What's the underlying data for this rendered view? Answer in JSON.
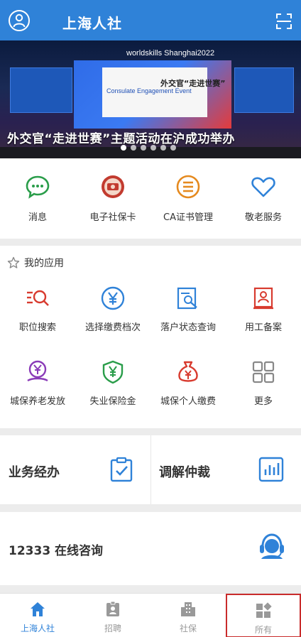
{
  "header": {
    "title": "上海人社",
    "avatar_icon": "user-circle-icon",
    "scan_icon": "scan-icon"
  },
  "banner": {
    "top_text": "worldskills  Shanghai2022",
    "mid_cn": "外交官“走进世赛”",
    "mid_en": "Consulate Engagement Event",
    "headline": "外交官“走进世赛”主题活动在沪成功举办",
    "dots": 6,
    "active_dot": 0
  },
  "quick": [
    {
      "label": "消息",
      "icon": "message-icon",
      "color": "#2a9d4a"
    },
    {
      "label": "电子社保卡",
      "icon": "social-card-icon",
      "color": "#c23b2f"
    },
    {
      "label": "CA证书管理",
      "icon": "certificate-icon",
      "color": "#e58a1f"
    },
    {
      "label": "敬老服务",
      "icon": "heart-icon",
      "color": "#2f82d8"
    }
  ],
  "apps": {
    "title": "我的应用",
    "star_icon": "star-outline-icon",
    "items": [
      {
        "label": "职位搜索",
        "icon": "job-search-icon",
        "color": "#d83b2f"
      },
      {
        "label": "选择缴费档次",
        "icon": "yen-circle-icon",
        "color": "#2f82d8"
      },
      {
        "label": "落户状态查询",
        "icon": "document-search-icon",
        "color": "#2f82d8"
      },
      {
        "label": "用工备案",
        "icon": "employee-file-icon",
        "color": "#d83b2f"
      },
      {
        "label": "城保养老发放",
        "icon": "pension-icon",
        "color": "#8a3bb8"
      },
      {
        "label": "失业保险金",
        "icon": "shield-yen-icon",
        "color": "#2a9d4a"
      },
      {
        "label": "城保个人缴费",
        "icon": "money-bag-icon",
        "color": "#d83b2f"
      },
      {
        "label": "更多",
        "icon": "grid-icon",
        "color": "#888888"
      }
    ]
  },
  "business": [
    {
      "label": "业务经办",
      "icon": "checklist-icon"
    },
    {
      "label": "调解仲裁",
      "icon": "bar-chart-icon"
    }
  ],
  "consult": {
    "label": "12333 在线咨询",
    "icon": "headset-icon"
  },
  "tabs": [
    {
      "label": "上海人社",
      "icon": "home-icon",
      "active": true
    },
    {
      "label": "招聘",
      "icon": "badge-icon",
      "active": false
    },
    {
      "label": "社保",
      "icon": "building-icon",
      "active": false
    },
    {
      "label": "所有",
      "icon": "all-apps-icon",
      "active": false
    }
  ],
  "colors": {
    "brand": "#2f82d8",
    "highlight": "#c92b2b"
  }
}
